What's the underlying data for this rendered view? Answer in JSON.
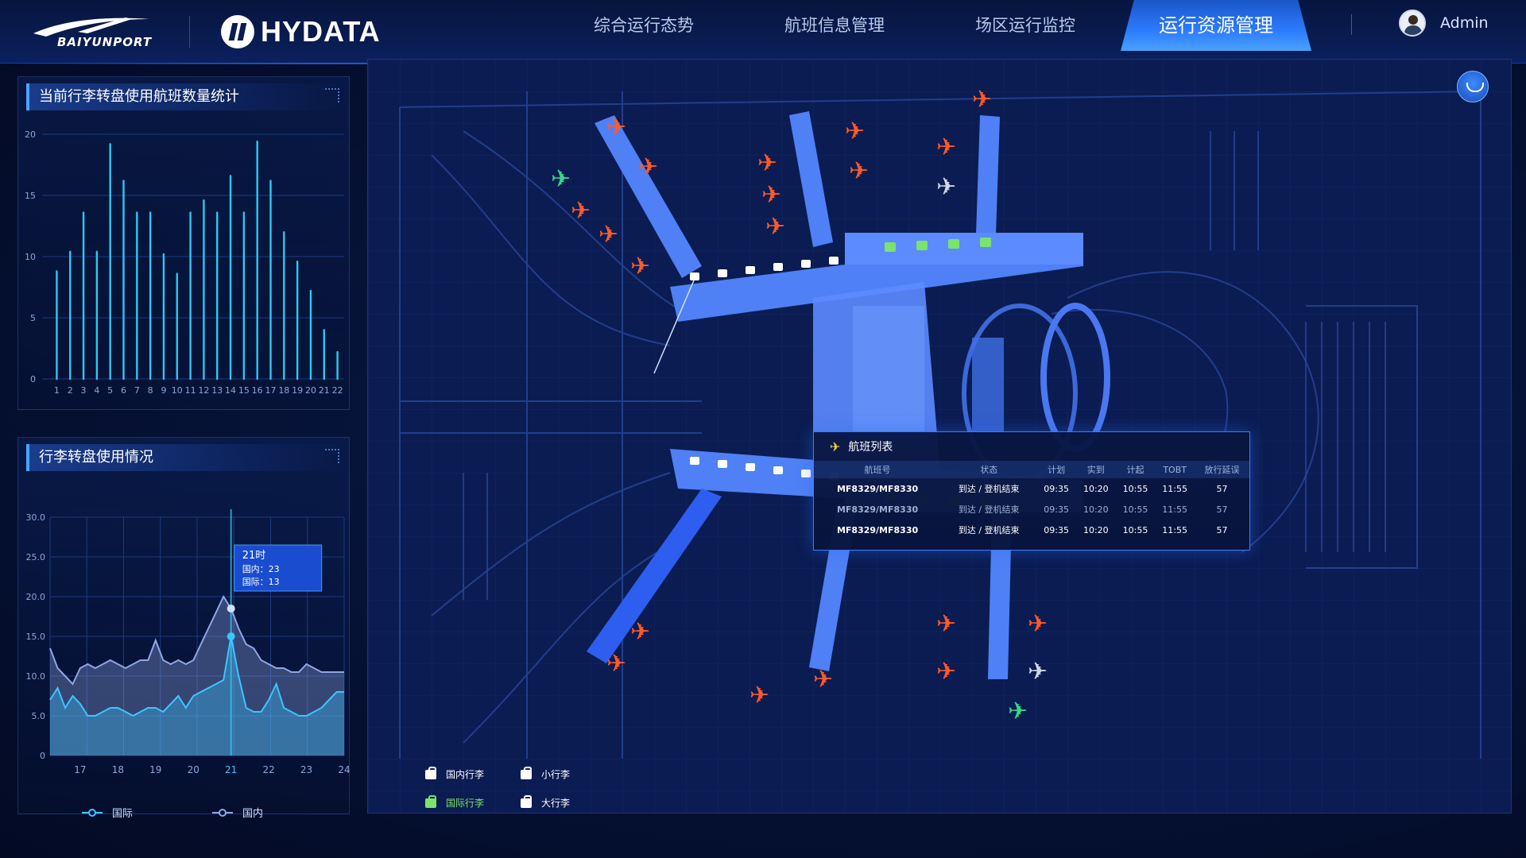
{
  "header": {
    "brand_left": "BAIYUNPORT",
    "brand_right": "HYDATA",
    "nav": [
      {
        "label": "综合运行态势"
      },
      {
        "label": "航班信息管理"
      },
      {
        "label": "场区运行监控"
      },
      {
        "label": "运行资源管理"
      }
    ],
    "active_nav": "运行资源管理",
    "user_name": "Admin"
  },
  "panels": {
    "bar_title": "当前行李转盘使用航班数量统计",
    "line_title": "行李转盘使用情况"
  },
  "chart_data": [
    {
      "type": "bar",
      "title": "当前行李转盘使用航班数量统计",
      "categories": [
        "1",
        "2",
        "3",
        "4",
        "5",
        "6",
        "7",
        "8",
        "9",
        "10",
        "11",
        "12",
        "13",
        "14",
        "15",
        "16",
        "17",
        "18",
        "19",
        "20",
        "21",
        "22"
      ],
      "values": [
        8.8,
        10.4,
        13.6,
        10.4,
        19.2,
        16.2,
        13.6,
        13.6,
        10.2,
        8.6,
        13.6,
        14.6,
        13.6,
        16.6,
        13.6,
        19.4,
        16.2,
        12.0,
        9.6,
        7.2,
        4.0,
        2.2
      ],
      "ylim": [
        0,
        20
      ],
      "yticks": [
        0,
        5,
        10,
        15,
        20
      ],
      "grid": true,
      "colors": {
        "bar": "#2ed3ff"
      }
    },
    {
      "type": "area",
      "title": "行李转盘使用情况",
      "x": [
        16.2,
        16.4,
        16.6,
        16.8,
        17.0,
        17.2,
        17.4,
        17.6,
        17.8,
        18.0,
        18.2,
        18.4,
        18.6,
        18.8,
        19.0,
        19.2,
        19.4,
        19.6,
        19.8,
        20.0,
        20.2,
        20.4,
        20.6,
        20.8,
        21.0,
        21.2,
        21.4,
        21.6,
        21.8,
        22.0,
        22.2,
        22.4,
        22.6,
        22.8,
        23.0,
        23.2,
        23.4,
        23.6,
        23.8,
        24.0
      ],
      "series": [
        {
          "name": "国际",
          "color": "#3bc6ff",
          "values": [
            7.0,
            8.5,
            6.0,
            7.5,
            6.5,
            5.0,
            5.0,
            5.5,
            6.0,
            6.0,
            5.5,
            5.0,
            5.5,
            6.0,
            6.0,
            5.5,
            6.5,
            7.5,
            6.0,
            7.5,
            8.0,
            8.5,
            9.0,
            9.5,
            15.0,
            10.0,
            6.0,
            5.5,
            5.5,
            7.0,
            9.0,
            6.0,
            5.5,
            5.0,
            5.0,
            5.5,
            6.0,
            7.0,
            8.0,
            8.0
          ]
        },
        {
          "name": "国内",
          "color": "#8fa6e6",
          "values": [
            13.5,
            11.0,
            10.0,
            9.0,
            11.0,
            11.5,
            11.0,
            11.5,
            12.0,
            11.5,
            11.0,
            11.5,
            12.0,
            12.0,
            14.5,
            12.0,
            11.5,
            12.0,
            11.5,
            12.0,
            14.0,
            16.0,
            18.0,
            20.0,
            18.5,
            16.0,
            14.0,
            13.5,
            12.0,
            11.5,
            11.0,
            11.0,
            10.5,
            10.5,
            11.5,
            11.0,
            10.5,
            10.5,
            10.5,
            10.5
          ]
        }
      ],
      "xticks": [
        "17",
        "18",
        "19",
        "20",
        "21",
        "22",
        "23",
        "24"
      ],
      "ylim": [
        0,
        30
      ],
      "yticks": [
        "0",
        "5.0",
        "10.0",
        "15.0",
        "20.0",
        "25.0",
        "30.0"
      ],
      "highlight_x": "21",
      "tooltip": {
        "title": "21时",
        "line1": "国内：23",
        "line2": "国际：13"
      },
      "legend": [
        "国际",
        "国内"
      ]
    }
  ],
  "flight_popup": {
    "title": "航班列表",
    "columns": [
      "航班号",
      "状态",
      "计划",
      "实到",
      "计起",
      "TOBT",
      "放行延误"
    ],
    "rows": [
      {
        "no": "MF8329/MF8330",
        "status": "到达 / 登机结束",
        "plan": "09:35",
        "actual": "10:20",
        "est": "10:55",
        "tobt": "11:55",
        "delay": "57"
      },
      {
        "no": "MF8329/MF8330",
        "status": "到达 / 登机结束",
        "plan": "09:35",
        "actual": "10:20",
        "est": "10:55",
        "tobt": "11:55",
        "delay": "57"
      },
      {
        "no": "MF8329/MF8330",
        "status": "到达 / 登机结束",
        "plan": "09:35",
        "actual": "10:20",
        "est": "10:55",
        "tobt": "11:55",
        "delay": "57"
      }
    ]
  },
  "map_legend": {
    "domestic": "国内行李",
    "small": "小行李",
    "international": "国际行李",
    "large": "大行李"
  },
  "colors": {
    "accent": "#2c7bff",
    "aircraft_orange": "#ff5a2a",
    "aircraft_green": "#36d68a",
    "aircraft_gray": "#cfd6e6",
    "international_green": "#79e36c"
  }
}
